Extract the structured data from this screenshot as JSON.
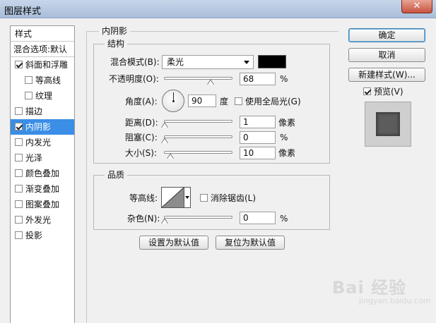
{
  "window": {
    "title": "图层样式",
    "close_label": "✕"
  },
  "sidebar": {
    "header": "样式",
    "blend_options": "混合选项:默认",
    "items": [
      {
        "label": "斜面和浮雕",
        "checked": true,
        "sub": false,
        "selected": false
      },
      {
        "label": "等高线",
        "checked": false,
        "sub": true,
        "selected": false
      },
      {
        "label": "纹理",
        "checked": false,
        "sub": true,
        "selected": false
      },
      {
        "label": "描边",
        "checked": false,
        "sub": false,
        "selected": false
      },
      {
        "label": "内阴影",
        "checked": true,
        "sub": false,
        "selected": true
      },
      {
        "label": "内发光",
        "checked": false,
        "sub": false,
        "selected": false
      },
      {
        "label": "光泽",
        "checked": false,
        "sub": false,
        "selected": false
      },
      {
        "label": "颜色叠加",
        "checked": false,
        "sub": false,
        "selected": false
      },
      {
        "label": "渐变叠加",
        "checked": false,
        "sub": false,
        "selected": false
      },
      {
        "label": "图案叠加",
        "checked": false,
        "sub": false,
        "selected": false
      },
      {
        "label": "外发光",
        "checked": false,
        "sub": false,
        "selected": false
      },
      {
        "label": "投影",
        "checked": false,
        "sub": false,
        "selected": false
      }
    ]
  },
  "inner_shadow": {
    "section_title": "内阴影",
    "structure": {
      "title": "结构",
      "blend_mode_label": "混合模式(B):",
      "blend_mode_value": "柔光",
      "shadow_color": "#000000",
      "opacity_label": "不透明度(O):",
      "opacity_value": "68",
      "opacity_unit": "%",
      "opacity_level": 0.68,
      "angle_label": "角度(A):",
      "angle_value": "90",
      "angle_unit": "度",
      "global_light_label": "使用全局光(G)",
      "global_light_checked": false,
      "distance_label": "距离(D):",
      "distance_value": "1",
      "distance_unit": "像素",
      "choke_label": "阻塞(C):",
      "choke_value": "0",
      "choke_unit": "%",
      "size_label": "大小(S):",
      "size_value": "10",
      "size_unit": "像素"
    },
    "quality": {
      "title": "品质",
      "contour_label": "等高线:",
      "anti_alias_label": "消除锯齿(L)",
      "anti_alias_checked": false,
      "noise_label": "杂色(N):",
      "noise_value": "0",
      "noise_unit": "%"
    },
    "make_default_label": "设置为默认值",
    "reset_default_label": "复位为默认值"
  },
  "buttons": {
    "ok_label": "确定",
    "cancel_label": "取消",
    "new_style_label": "新建样式(W)...",
    "preview_label": "预览(V)",
    "preview_checked": true
  },
  "watermark": {
    "text": "Bai 经验",
    "sub": "jingyan.baidu.com"
  }
}
